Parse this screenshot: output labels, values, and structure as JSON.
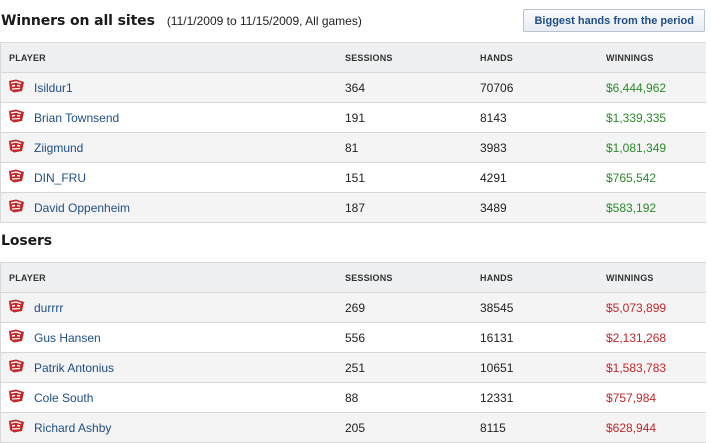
{
  "winners": {
    "title": "Winners on all sites",
    "period": "(11/1/2009 to 11/15/2009, All games)",
    "button_label": "Biggest hands from the period",
    "columns": [
      "PLAYER",
      "SESSIONS",
      "HANDS",
      "WINNINGS"
    ],
    "rows": [
      {
        "player": "Isildur1",
        "sessions": "364",
        "hands": "70706",
        "winnings": "$6,444,962"
      },
      {
        "player": "Brian Townsend",
        "sessions": "191",
        "hands": "8143",
        "winnings": "$1,339,335"
      },
      {
        "player": "Ziigmund",
        "sessions": "81",
        "hands": "3983",
        "winnings": "$1,081,349"
      },
      {
        "player": "DIN_FRU",
        "sessions": "151",
        "hands": "4291",
        "winnings": "$765,542"
      },
      {
        "player": "David Oppenheim",
        "sessions": "187",
        "hands": "3489",
        "winnings": "$583,192"
      }
    ]
  },
  "losers": {
    "title": "Losers",
    "columns": [
      "PLAYER",
      "SESSIONS",
      "HANDS",
      "WINNINGS"
    ],
    "rows": [
      {
        "player": "durrrr",
        "sessions": "269",
        "hands": "38545",
        "winnings": "$5,073,899"
      },
      {
        "player": "Gus Hansen",
        "sessions": "556",
        "hands": "16131",
        "winnings": "$2,131,268"
      },
      {
        "player": "Patrik Antonius",
        "sessions": "251",
        "hands": "10651",
        "winnings": "$1,583,783"
      },
      {
        "player": "Cole South",
        "sessions": "88",
        "hands": "12331",
        "winnings": "$757,984"
      },
      {
        "player": "Richard Ashby",
        "sessions": "205",
        "hands": "8115",
        "winnings": "$628,944"
      }
    ]
  },
  "icons": {
    "player": "poker-site-logo-icon"
  },
  "colors": {
    "link": "#1f4e86",
    "positive": "#2b8a2b",
    "negative": "#c0282b",
    "header_bg": "#eef0f1"
  }
}
